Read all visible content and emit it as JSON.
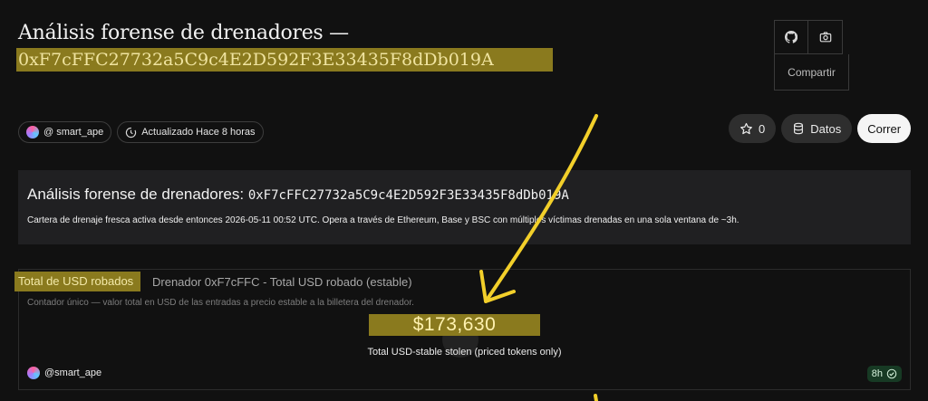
{
  "header": {
    "title_line1": "Análisis forense de drenadores —",
    "title_line2": "0xF7cFFC27732a5C9c4E2D592F3E33435F8dDb019A"
  },
  "top_actions": {
    "github_icon": "github-icon",
    "camera_icon": "camera-icon",
    "share_label": "Compartir"
  },
  "meta": {
    "author": "@ smart_ape",
    "updated": "Actualizado Hace 8 horas"
  },
  "actions": {
    "star_count": "0",
    "data_label": "Datos",
    "run_label": "Correr"
  },
  "description_card": {
    "title_text": "Análisis forense de drenadores: ",
    "title_address": "0xF7cFFC27732a5C9c4E2D592F3E33435F8dDb019A",
    "body": "Cartera de drenaje fresca activa desde entonces 2026-05-11 00:52 UTC. Opera a través de Ethereum, Base y BSC con múltiples víctimas drenadas en una sola ventana de ~3h."
  },
  "counter_card": {
    "tag": "Total de USD robados",
    "title": "Drenador 0xF7cFFC - Total USD robado (estable)",
    "description": "Contador único — valor total en USD de las entradas a precio estable a la billetera del drenador.",
    "value": "$173,630",
    "subtitle": "Total USD-stable stolen (priced tokens only)",
    "author": "@smart_ape",
    "freshness": "8h"
  },
  "colors": {
    "highlight": "#8a7a1e",
    "arrow": "#f2cf2a",
    "background": "#111111",
    "card": "#202022",
    "fresh_badge": "#173a24"
  }
}
